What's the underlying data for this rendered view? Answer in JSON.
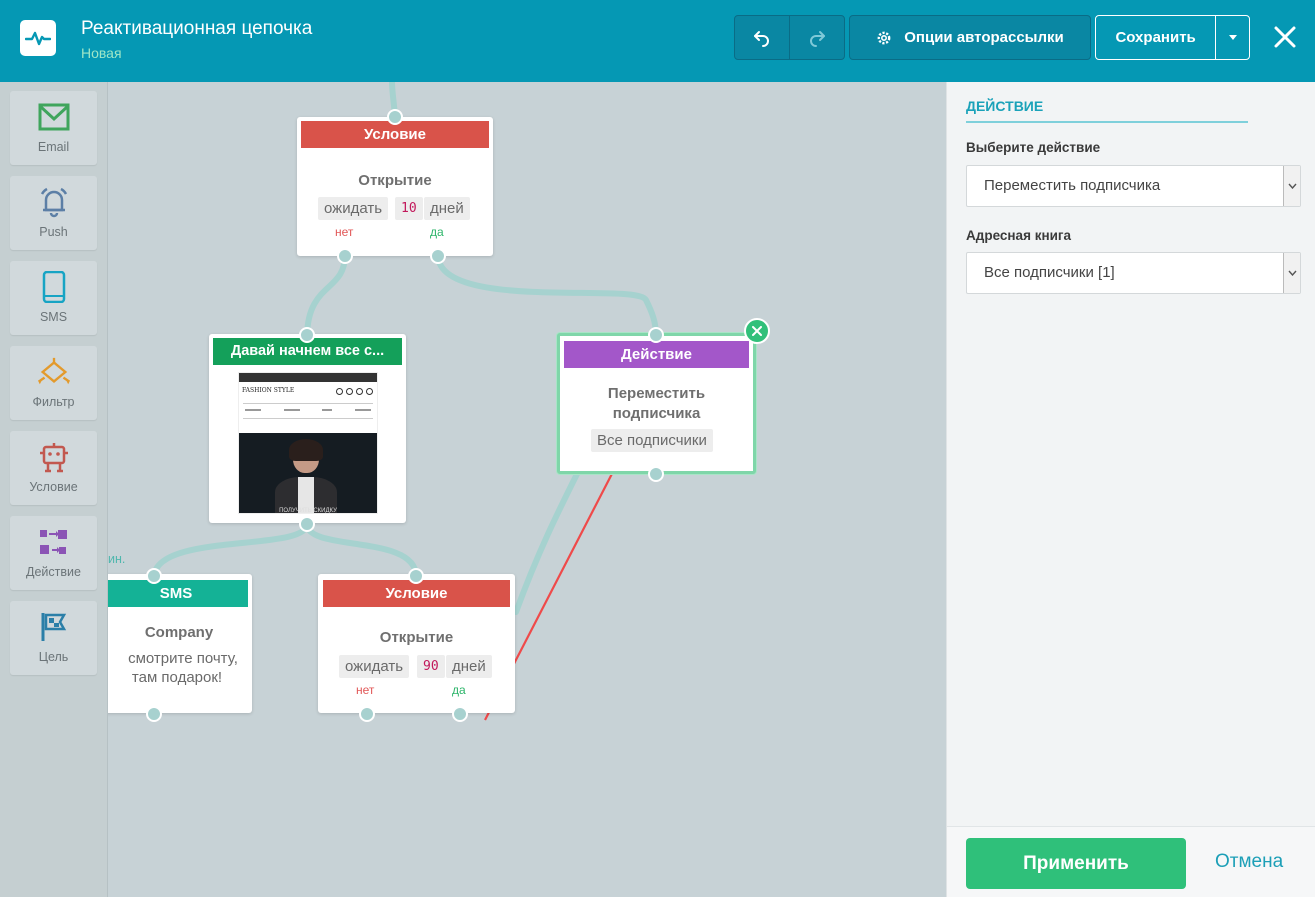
{
  "header": {
    "title": "Реактивационная цепочка",
    "subtitle": "Новая",
    "options_label": "Опции авторассылки",
    "save_label": "Сохранить"
  },
  "palette": [
    {
      "label": "Email",
      "icon": "email-icon"
    },
    {
      "label": "Push",
      "icon": "bell-icon"
    },
    {
      "label": "SMS",
      "icon": "phone-icon"
    },
    {
      "label": "Фильтр",
      "icon": "filter-icon"
    },
    {
      "label": "Условие",
      "icon": "robot-icon"
    },
    {
      "label": "Действие",
      "icon": "action-icon"
    },
    {
      "label": "Цель",
      "icon": "flag-icon"
    }
  ],
  "nodes": {
    "condition_top": {
      "head": "Условие",
      "title": "Открытие",
      "wait": "ожидать",
      "days_num": "10",
      "days": "дней",
      "no": "нет",
      "yes": "да"
    },
    "email": {
      "head": "Давай начнем все с...",
      "preview_cta": "ПОЛУЧИТЬ СКИДКУ",
      "brand": "FASHION STYLE"
    },
    "action": {
      "head": "Действие",
      "title_line1": "Переместить",
      "title_line2": "подписчика",
      "book": "Все подписчики"
    },
    "sms": {
      "head": "SMS",
      "title": "Company",
      "line1": "смотрите почту,",
      "line2": "там подарок!",
      "edge_label": "ин."
    },
    "condition_bottom": {
      "head": "Условие",
      "title": "Открытие",
      "wait": "ожидать",
      "days_num": "90",
      "days": "дней",
      "no": "нет",
      "yes": "да"
    }
  },
  "colors": {
    "header_bg": "#0598b4",
    "condition": "#d9534a",
    "email": "#14a05a",
    "action": "#a357c9",
    "sms": "#14b296",
    "apply": "#2fc07a"
  },
  "panel": {
    "section_title": "ДЕЙСТВИЕ",
    "action_label": "Выберите действие",
    "action_value": "Переместить подписчика",
    "book_label": "Адресная книга",
    "book_value": "Все подписчики [1]",
    "apply_label": "Применить",
    "cancel_label": "Отмена"
  }
}
